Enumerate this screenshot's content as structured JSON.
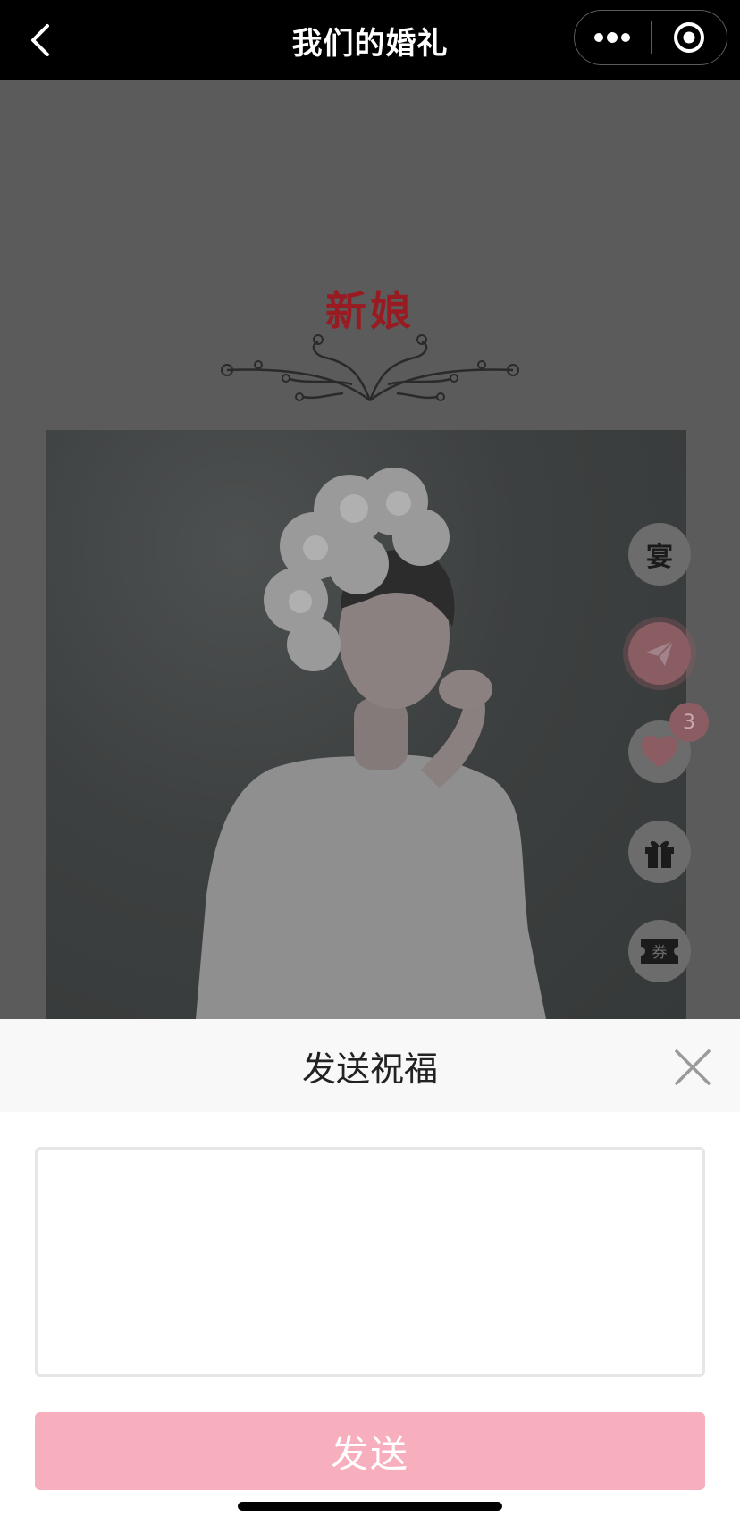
{
  "navbar": {
    "title": "我们的婚礼",
    "back_icon": "chevron-left-icon",
    "more_icon": "more-dots-icon",
    "close_icon": "target-circle-icon"
  },
  "content": {
    "section_title": "新娘",
    "ornament_icon": "floral-ornament-icon",
    "photo_alt": "bride-photo"
  },
  "side_buttons": [
    {
      "name": "banquet",
      "label": "宴"
    },
    {
      "name": "send",
      "icon": "paper-plane-icon"
    },
    {
      "name": "like",
      "icon": "heart-icon",
      "badge": "3"
    },
    {
      "name": "gift",
      "icon": "gift-icon"
    },
    {
      "name": "coupon",
      "label": "券",
      "icon": "ticket-icon"
    }
  ],
  "sheet": {
    "title": "发送祝福",
    "input_value": "",
    "input_placeholder": "",
    "send_label": "发送",
    "send_color": "#f7aebd"
  },
  "colors": {
    "navbar_bg": "#000000",
    "overlay_bg": "#5b5b5b",
    "title_red": "#9a1a22"
  }
}
